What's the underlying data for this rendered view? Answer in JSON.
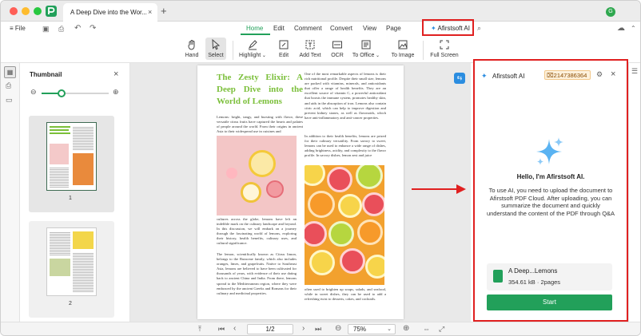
{
  "window": {
    "tab_title": "A Deep Dive into the Wor...",
    "add_tab": "+",
    "avatar_letter": "G"
  },
  "toolbar": {
    "file_label": "File",
    "tabs": [
      "Home",
      "Edit",
      "Comment",
      "Convert",
      "View",
      "Page"
    ],
    "active_tab": "Home",
    "ai_button": "Afirstsoft AI",
    "tools": {
      "hand": "Hand",
      "select": "Select",
      "highlight": "Highlight",
      "edit": "Edit",
      "add_text": "Add Text",
      "ocr": "OCR",
      "to_office": "To Office",
      "to_image": "To Image",
      "full_screen": "Full Screen"
    }
  },
  "thumbnail": {
    "title": "Thumbnail",
    "page1": "1",
    "page2": "2",
    "zoom_level": 0.3
  },
  "document": {
    "title": "The Zesty Elixir: A Deep Dive into the World of Lemons",
    "col1_p1": "Lemons: bright, tangy, and bursting with flavor, these versatile citrus fruits have captured the hearts and palates of people around the world. From their origins in ancient Asia to their widespread use in cuisines and",
    "col1_p2": "cultures across the globe, lemons have left an indelible mark on the culinary landscape and beyond. In this discussion, we will embark on a journey through the fascinating world of lemons, exploring their history, health benefits, culinary uses, and cultural significance.",
    "col1_p3": "The lemon, scientifically known as Citrus limon, belongs to the Rutaceae family, which also includes oranges, limes, and grapefruits. Native to Southeast Asia, lemons are believed to have been cultivated for thousands of years, with evidence of their use dating back to ancient China and India. From there, lemons spread to the Mediterranean region, where they were embraced by the ancient Greeks and Romans for their culinary and medicinal properties.",
    "col2_p1": "One of the most remarkable aspects of lemons is their rich nutritional profile. Despite their small size, lemons are packed with vitamins, minerals, and antioxidants that offer a range of health benefits. They are an excellent source of vitamin C, a powerful antioxidant that boosts the immune system, promotes healthy skin, and aids in the absorption of iron. Lemons also contain citric acid, which can help to improve digestion and prevent kidney stones, as well as flavonoids, which have anti-inflammatory and anti-cancer properties.",
    "col2_p2": "In addition to their health benefits, lemons are prized for their culinary versatility. From savory to sweet, lemons can be used to enhance a wide range of dishes, adding brightness, acidity, and complexity to the flavor profile. In savory dishes, lemon zest and juice",
    "col2_p3": "often used to brighten up soups, salads, and seafood, while in sweet dishes, they can be used to add a refreshing twist to desserts, cakes, and cocktails."
  },
  "ai_panel": {
    "title": "Afirstsoft AI",
    "credits": "2147386364",
    "greeting": "Hello, I'm Afirstsoft AI.",
    "description": "To use AI, you need to upload the document to Afirstsoft PDF Cloud. After uploading, you can summarize the document and quickly understand the content of the PDF through Q&A",
    "file_name": "A Deep...Lemons",
    "file_meta": "354.61 kB · 2pages",
    "start_button": "Start"
  },
  "bottombar": {
    "page_indicator": "1/2",
    "zoom": "75%"
  },
  "colors": {
    "accent": "#22a05a",
    "title_green": "#7bbf3a",
    "highlight_red": "#e02020",
    "ai_blue": "#2b8de0"
  }
}
